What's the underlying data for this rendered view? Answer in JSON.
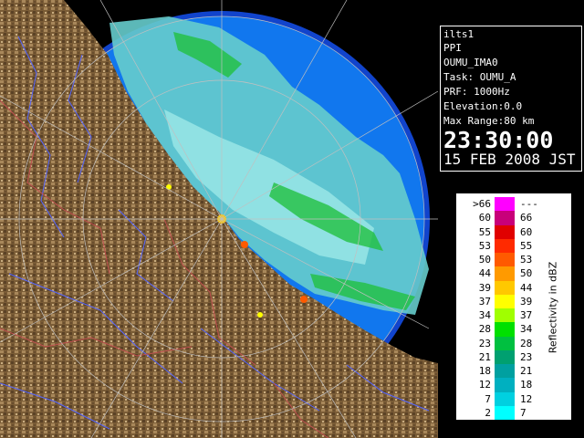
{
  "info": {
    "station": "ilts1",
    "scan_type": "PPI",
    "site_id": "OUMU_IMA0",
    "task": "Task: OUMU_A",
    "prf": "PRF: 1000Hz",
    "elevation": "Elevation:0.0",
    "max_range": "Max Range:80 km",
    "time": "23:30:00",
    "date": "15 FEB 2008 JST"
  },
  "legend": {
    "title": "Reflectivity in dBZ",
    "rows": [
      {
        "lo": ">66",
        "hi": "---",
        "color": "#ff00ff"
      },
      {
        "lo": "60",
        "hi": "66",
        "color": "#c8007a"
      },
      {
        "lo": "55",
        "hi": "60",
        "color": "#e00000"
      },
      {
        "lo": "53",
        "hi": "55",
        "color": "#ff2a00"
      },
      {
        "lo": "50",
        "hi": "53",
        "color": "#ff5a00"
      },
      {
        "lo": "44",
        "hi": "50",
        "color": "#ff9a00"
      },
      {
        "lo": "39",
        "hi": "44",
        "color": "#ffc800"
      },
      {
        "lo": "37",
        "hi": "39",
        "color": "#ffff00"
      },
      {
        "lo": "34",
        "hi": "37",
        "color": "#a0ff00"
      },
      {
        "lo": "28",
        "hi": "34",
        "color": "#00e000"
      },
      {
        "lo": "23",
        "hi": "28",
        "color": "#00c040"
      },
      {
        "lo": "21",
        "hi": "23",
        "color": "#00a070"
      },
      {
        "lo": "18",
        "hi": "21",
        "color": "#00a0a0"
      },
      {
        "lo": "12",
        "hi": "18",
        "color": "#00b0c0"
      },
      {
        "lo": "7",
        "hi": "12",
        "color": "#00d0e0"
      },
      {
        "lo": "2",
        "hi": "7",
        "color": "#00ffff"
      }
    ]
  },
  "colors": {
    "sea": "#1177ee",
    "outer_range": "#1144cc",
    "land": "#8a6a40",
    "river": "#5566ff",
    "border": "#c05050"
  }
}
